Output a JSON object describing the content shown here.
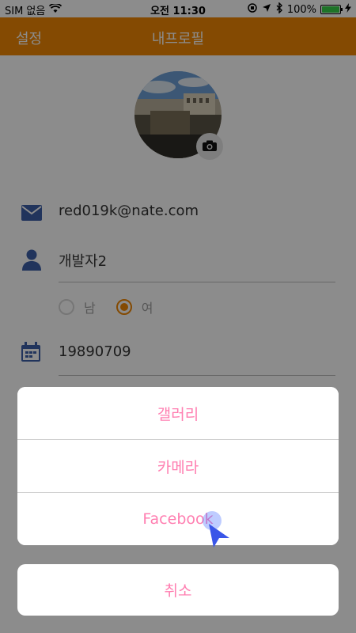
{
  "status_bar": {
    "carrier": "SIM 없음",
    "time": "오전 11:30",
    "battery_percent": "100%"
  },
  "navbar": {
    "back_label": "설정",
    "title": "내프로필"
  },
  "profile": {
    "email": "red019k@nate.com",
    "name": "개발자2",
    "gender_options": [
      "남",
      "여"
    ],
    "selected_gender": "여",
    "birthdate": "19890709"
  },
  "action_sheet": {
    "items": [
      "갤러리",
      "카메라",
      "Facebook"
    ],
    "cancel": "취소"
  },
  "colors": {
    "accent": "#f18704",
    "sheet_text": "#ff7fb1",
    "icon": "#3d5fa8"
  }
}
